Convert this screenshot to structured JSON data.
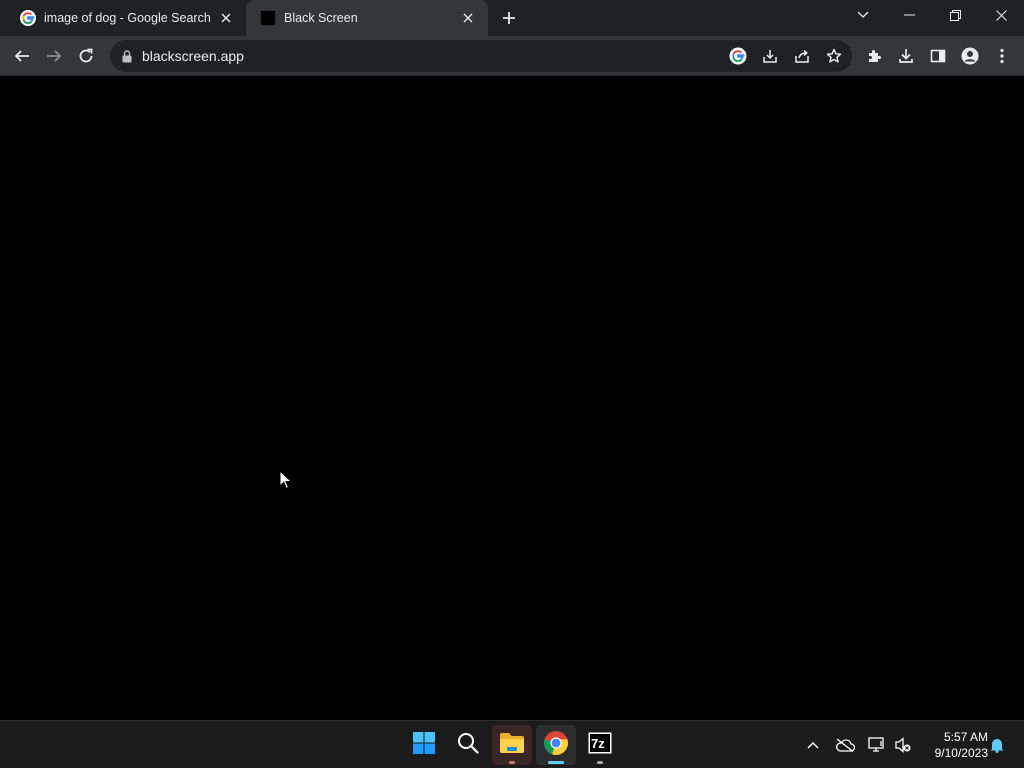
{
  "browser": {
    "tabs": [
      {
        "title": "image of dog - Google Search",
        "favicon": "google-g-icon",
        "active": false
      },
      {
        "title": "Black Screen",
        "favicon": "black-square-icon",
        "active": true
      }
    ],
    "address_bar": {
      "url": "blackscreen.app"
    }
  },
  "page": {
    "background": "#000000"
  },
  "taskbar": {
    "apps": [
      "windows-start",
      "search",
      "file-explorer",
      "google-chrome",
      "7-zip"
    ],
    "clock": {
      "time": "5:57 AM",
      "date": "9/10/2023"
    }
  },
  "colors": {
    "tabstrip": "#202124",
    "toolbar": "#35363a",
    "omnibox": "#202124",
    "text": "#e8eaed",
    "taskbar": "#1c1c1c",
    "accent_blue": "#60cdff"
  }
}
